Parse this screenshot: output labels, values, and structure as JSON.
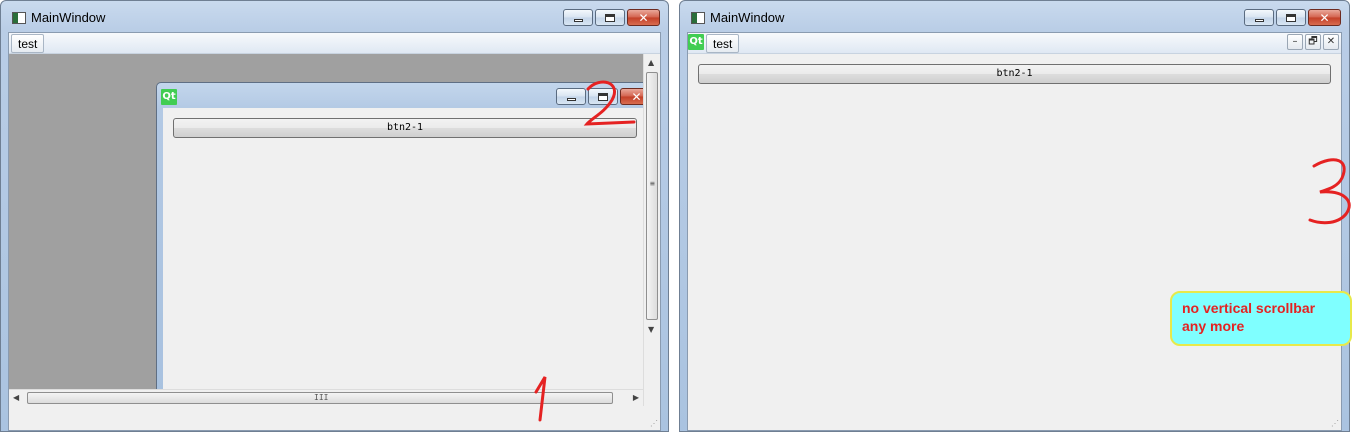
{
  "left_window": {
    "title": "MainWindow",
    "menu": [
      {
        "label": "test"
      }
    ],
    "subwindow": {
      "logo_text": "Qt",
      "button_label": "btn2-1"
    },
    "hscroll_grip": "III",
    "vscroll_grip": "≡"
  },
  "right_window": {
    "title": "MainWindow",
    "menu": [
      {
        "label": "test"
      }
    ],
    "logo_text": "Qt",
    "mdi_controls": {
      "minimize": "–",
      "restore": "🗗",
      "close": "✕"
    },
    "button_label": "btn2-1"
  },
  "annotations": {
    "one": "1",
    "two": "2",
    "three": "3",
    "callout": "no vertical scrollbar any more"
  },
  "colors": {
    "annotation_red": "#e52222",
    "callout_fill": "#7fffff",
    "callout_border": "#e7e94a",
    "qt_green": "#41cd52",
    "mdi_background": "#a0a0a0"
  }
}
